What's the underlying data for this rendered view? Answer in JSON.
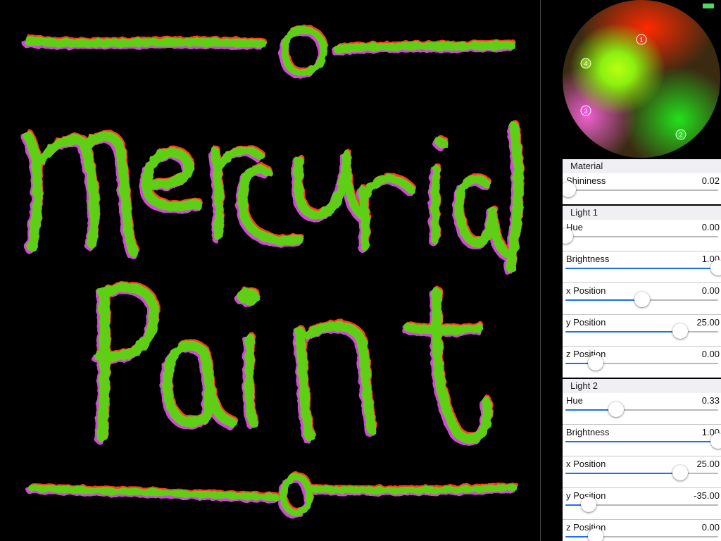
{
  "sphere": {
    "lights": [
      {
        "label": "1",
        "color": "#ff2b2b"
      },
      {
        "label": "2",
        "color": "#33ff33"
      },
      {
        "label": "3",
        "color": "#ff4dff"
      },
      {
        "label": "4",
        "color": "#a6ff1a"
      }
    ]
  },
  "canvas": {
    "paint_color": "#5fcf18",
    "highlight_color": "#ff3a1a",
    "shadow_color": "#d04ad8"
  },
  "material": {
    "title": "Material",
    "shininess": {
      "label": "Shininess",
      "value": "0.02",
      "fraction": 0.02
    }
  },
  "light1": {
    "title": "Light 1",
    "hue": {
      "label": "Hue",
      "value": "0.00",
      "fraction": 0.0
    },
    "brightness": {
      "label": "Brightness",
      "value": "1.00",
      "fraction": 1.0
    },
    "x_position": {
      "label": "x Position",
      "value": "0.00",
      "fraction": 0.5
    },
    "y_position": {
      "label": "y Position",
      "value": "25.00",
      "fraction": 0.75
    },
    "z_position": {
      "label": "z Position",
      "value": "0.00",
      "fraction": 0.2
    }
  },
  "light2": {
    "title": "Light 2",
    "hue": {
      "label": "Hue",
      "value": "0.33",
      "fraction": 0.33
    },
    "brightness": {
      "label": "Brightness",
      "value": "1.00",
      "fraction": 1.0
    },
    "x_position": {
      "label": "x Position",
      "value": "25.00",
      "fraction": 0.75
    },
    "y_position": {
      "label": "y Position",
      "value": "-35.00",
      "fraction": 0.15
    },
    "z_position": {
      "label": "z Position",
      "value": "0.00",
      "fraction": 0.2
    }
  },
  "colors": {
    "slider_fill": "#1b6ef3",
    "battery": "#4cd964"
  }
}
